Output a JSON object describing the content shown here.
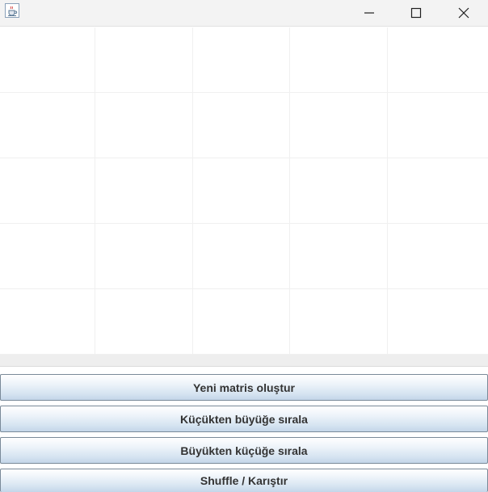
{
  "window": {
    "icon": "java-cup-icon",
    "controls": {
      "minimize_icon": "minimize-icon",
      "maximize_icon": "maximize-icon",
      "close_icon": "close-icon"
    }
  },
  "matrix": {
    "rows": [
      [
        "",
        "",
        "",
        "",
        ""
      ],
      [
        "",
        "",
        "",
        "",
        ""
      ],
      [
        "",
        "",
        "",
        "",
        ""
      ],
      [
        "",
        "",
        "",
        "",
        ""
      ],
      [
        "",
        "",
        "",
        "",
        ""
      ]
    ]
  },
  "buttons": {
    "new_matrix": "Yeni matris oluştur",
    "sort_ascending": "Küçükten büyüğe sırala",
    "sort_descending": "Büyükten küçüğe sırala",
    "shuffle": "Shuffle / Karıştır"
  }
}
